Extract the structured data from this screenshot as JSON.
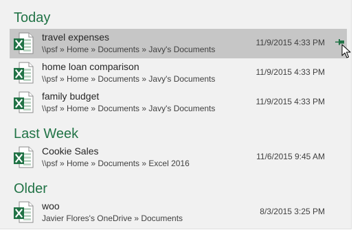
{
  "colors": {
    "accent": "#217346",
    "panel_bg": "#f1f1f1",
    "selected_bg": "#c6c6c6"
  },
  "sections": [
    {
      "header": "Today",
      "items": [
        {
          "name": "travel expenses",
          "path": "\\\\psf » Home » Documents » Javy's Documents",
          "date": "11/9/2015 4:33 PM",
          "icon": "excel-file-icon",
          "selected": true,
          "pinned": true
        },
        {
          "name": "home loan comparison",
          "path": "\\\\psf » Home » Documents » Javy's Documents",
          "date": "11/9/2015 4:33 PM",
          "icon": "excel-file-icon",
          "selected": false,
          "pinned": false
        },
        {
          "name": "family budget",
          "path": "\\\\psf » Home » Documents » Javy's Documents",
          "date": "11/9/2015 4:33 PM",
          "icon": "excel-file-icon",
          "selected": false,
          "pinned": false
        }
      ]
    },
    {
      "header": "Last Week",
      "items": [
        {
          "name": "Cookie Sales",
          "path": "\\\\psf » Home » Documents » Excel 2016",
          "date": "11/6/2015 9:45 AM",
          "icon": "excel-file-icon",
          "selected": false,
          "pinned": false
        }
      ]
    },
    {
      "header": "Older",
      "items": [
        {
          "name": "woo",
          "path": "Javier Flores's OneDrive » Documents",
          "date": "8/3/2015 3:25 PM",
          "icon": "excel-file-icon",
          "selected": false,
          "pinned": false
        }
      ]
    }
  ]
}
